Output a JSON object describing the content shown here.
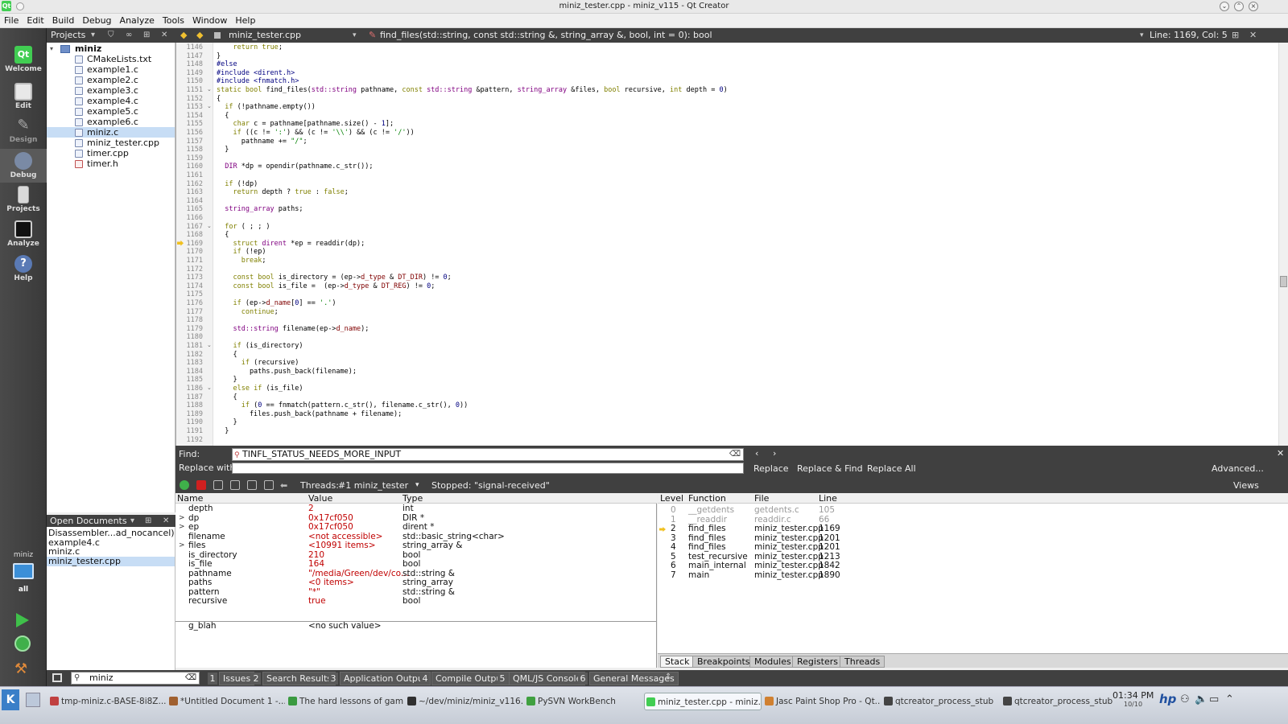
{
  "window": {
    "title": "miniz_tester.cpp - miniz_v115 - Qt Creator"
  },
  "menu": [
    "File",
    "Edit",
    "Build",
    "Debug",
    "Analyze",
    "Tools",
    "Window",
    "Help"
  ],
  "modes": [
    {
      "label": "Welcome",
      "icon": "qt-logo-icon"
    },
    {
      "label": "Edit",
      "icon": "document-edit-icon"
    },
    {
      "label": "Design",
      "icon": "design-pen-icon"
    },
    {
      "label": "Debug",
      "icon": "bug-icon"
    },
    {
      "label": "Projects",
      "icon": "projects-book-icon"
    },
    {
      "label": "Analyze",
      "icon": "analyze-monitor-icon"
    },
    {
      "label": "Help",
      "icon": "help-icon"
    }
  ],
  "kit": {
    "name": "miniz",
    "config": "all"
  },
  "projects": {
    "pane_label": "Projects",
    "root": "miniz",
    "files": [
      "CMakeLists.txt",
      "example1.c",
      "example2.c",
      "example3.c",
      "example4.c",
      "example5.c",
      "example6.c",
      "miniz.c",
      "miniz_tester.cpp",
      "timer.cpp",
      "timer.h"
    ],
    "selected_index": 7
  },
  "open_documents": {
    "label": "Open Documents",
    "items": [
      "Disassembler...ad_nocancel)",
      "example4.c",
      "miniz.c",
      "miniz_tester.cpp"
    ],
    "selected_index": 3
  },
  "editor": {
    "file": "miniz_tester.cpp",
    "function": "find_files(std::string, const std::string &, string_array &, bool, int = 0): bool",
    "position": "Line: 1169, Col: 5",
    "first_line": 1146,
    "current_line": 1169,
    "lines": [
      "    return true;",
      "}",
      "#else",
      "#include <dirent.h>",
      "#include <fnmatch.h>",
      "static bool find_files(std::string pathname, const std::string &pattern, string_array &files, bool recursive, int depth = 0)",
      "{",
      "  if (!pathname.empty())",
      "  {",
      "    char c = pathname[pathname.size() - 1];",
      "    if ((c != ':') && (c != '\\\\') && (c != '/'))",
      "      pathname += \"/\";",
      "  }",
      "",
      "  DIR *dp = opendir(pathname.c_str());",
      "",
      "  if (!dp)",
      "    return depth ? true : false;",
      "",
      "  string_array paths;",
      "",
      "  for ( ; ; )",
      "  {",
      "    struct dirent *ep = readdir(dp);",
      "    if (!ep)",
      "      break;",
      "",
      "    const bool is_directory = (ep->d_type & DT_DIR) != 0;",
      "    const bool is_file =  (ep->d_type & DT_REG) != 0;",
      "",
      "    if (ep->d_name[0] == '.')",
      "      continue;",
      "",
      "    std::string filename(ep->d_name);",
      "",
      "    if (is_directory)",
      "    {",
      "      if (recursive)",
      "        paths.push_back(filename);",
      "    }",
      "    else if (is_file)",
      "    {",
      "      if (0 == fnmatch(pattern.c_str(), filename.c_str(), 0))",
      "        files.push_back(pathname + filename);",
      "    }",
      "  }",
      ""
    ]
  },
  "find": {
    "find_label": "Find:",
    "find_value": "TINFL_STATUS_NEEDS_MORE_INPUT",
    "replace_label": "Replace with:",
    "replace_value": "",
    "buttons": [
      "Replace",
      "Replace & Find",
      "Replace All"
    ],
    "advanced": "Advanced..."
  },
  "debugger": {
    "threads_label": "Threads:",
    "thread": "#1 miniz_tester",
    "status": "Stopped: \"signal-received\"",
    "views": "Views"
  },
  "locals": {
    "headers": [
      "Name",
      "Value",
      "Type"
    ],
    "rows": [
      {
        "name": "depth",
        "value": "2",
        "type": "int",
        "exp": ""
      },
      {
        "name": "dp",
        "value": "0x17cf050",
        "type": "DIR *",
        "exp": ">"
      },
      {
        "name": "ep",
        "value": "0x17cf050",
        "type": "dirent *",
        "exp": ">"
      },
      {
        "name": "filename",
        "value": "<not accessible>",
        "type": "std::basic_string<char>",
        "exp": ""
      },
      {
        "name": "files",
        "value": "<10991 items>",
        "type": "string_array &",
        "exp": ">"
      },
      {
        "name": "is_directory",
        "value": "210",
        "type": "bool",
        "exp": ""
      },
      {
        "name": "is_file",
        "value": "164",
        "type": "bool",
        "exp": ""
      },
      {
        "name": "pathname",
        "value": "\"/media/Green/dev/co...",
        "type": "std::string &",
        "exp": ""
      },
      {
        "name": "paths",
        "value": "<0 items>",
        "type": "string_array",
        "exp": ""
      },
      {
        "name": "pattern",
        "value": "\"*\"",
        "type": "std::string &",
        "exp": ""
      },
      {
        "name": "recursive",
        "value": "true",
        "type": "bool",
        "exp": ""
      }
    ],
    "watch": {
      "name": "g_blah",
      "value": "<no such value>"
    }
  },
  "stack": {
    "headers": [
      "Level",
      "Function",
      "File",
      "Line"
    ],
    "rows": [
      {
        "level": "0",
        "function": "__getdents",
        "file": "getdents.c",
        "line": "105",
        "grey": true
      },
      {
        "level": "1",
        "function": "__readdir",
        "file": "readdir.c",
        "line": "66",
        "grey": true
      },
      {
        "level": "2",
        "function": "find_files",
        "file": "miniz_tester.cpp",
        "line": "1169",
        "grey": false
      },
      {
        "level": "3",
        "function": "find_files",
        "file": "miniz_tester.cpp",
        "line": "1201",
        "grey": false
      },
      {
        "level": "4",
        "function": "find_files",
        "file": "miniz_tester.cpp",
        "line": "1201",
        "grey": false
      },
      {
        "level": "5",
        "function": "test_recursive",
        "file": "miniz_tester.cpp",
        "line": "1213",
        "grey": false
      },
      {
        "level": "6",
        "function": "main_internal",
        "file": "miniz_tester.cpp",
        "line": "1842",
        "grey": false
      },
      {
        "level": "7",
        "function": "main",
        "file": "miniz_tester.cpp",
        "line": "1890",
        "grey": false
      }
    ],
    "tabs": [
      "Stack",
      "Breakpoints",
      "Modules",
      "Registers",
      "Threads"
    ]
  },
  "output": {
    "search_value": "miniz",
    "tabs": [
      {
        "n": "1",
        "label": "Issues"
      },
      {
        "n": "2",
        "label": "Search Results"
      },
      {
        "n": "3",
        "label": "Application Output"
      },
      {
        "n": "4",
        "label": "Compile Output"
      },
      {
        "n": "5",
        "label": "QML/JS Console"
      },
      {
        "n": "6",
        "label": "General Messages"
      }
    ]
  },
  "taskbar": {
    "items": [
      "tmp-miniz.c-BASE-8i8Z...",
      "*Untitled Document 1 -...",
      "The hard lessons of gam...",
      "~/dev/miniz/miniz_v116...",
      "PySVN WorkBench",
      "miniz_tester.cpp - miniz...",
      "Jasc Paint Shop Pro - Qt...",
      "qtcreator_process_stub",
      "qtcreator_process_stub"
    ],
    "active_index": 5,
    "time": "01:34 PM",
    "date": "10/10"
  }
}
